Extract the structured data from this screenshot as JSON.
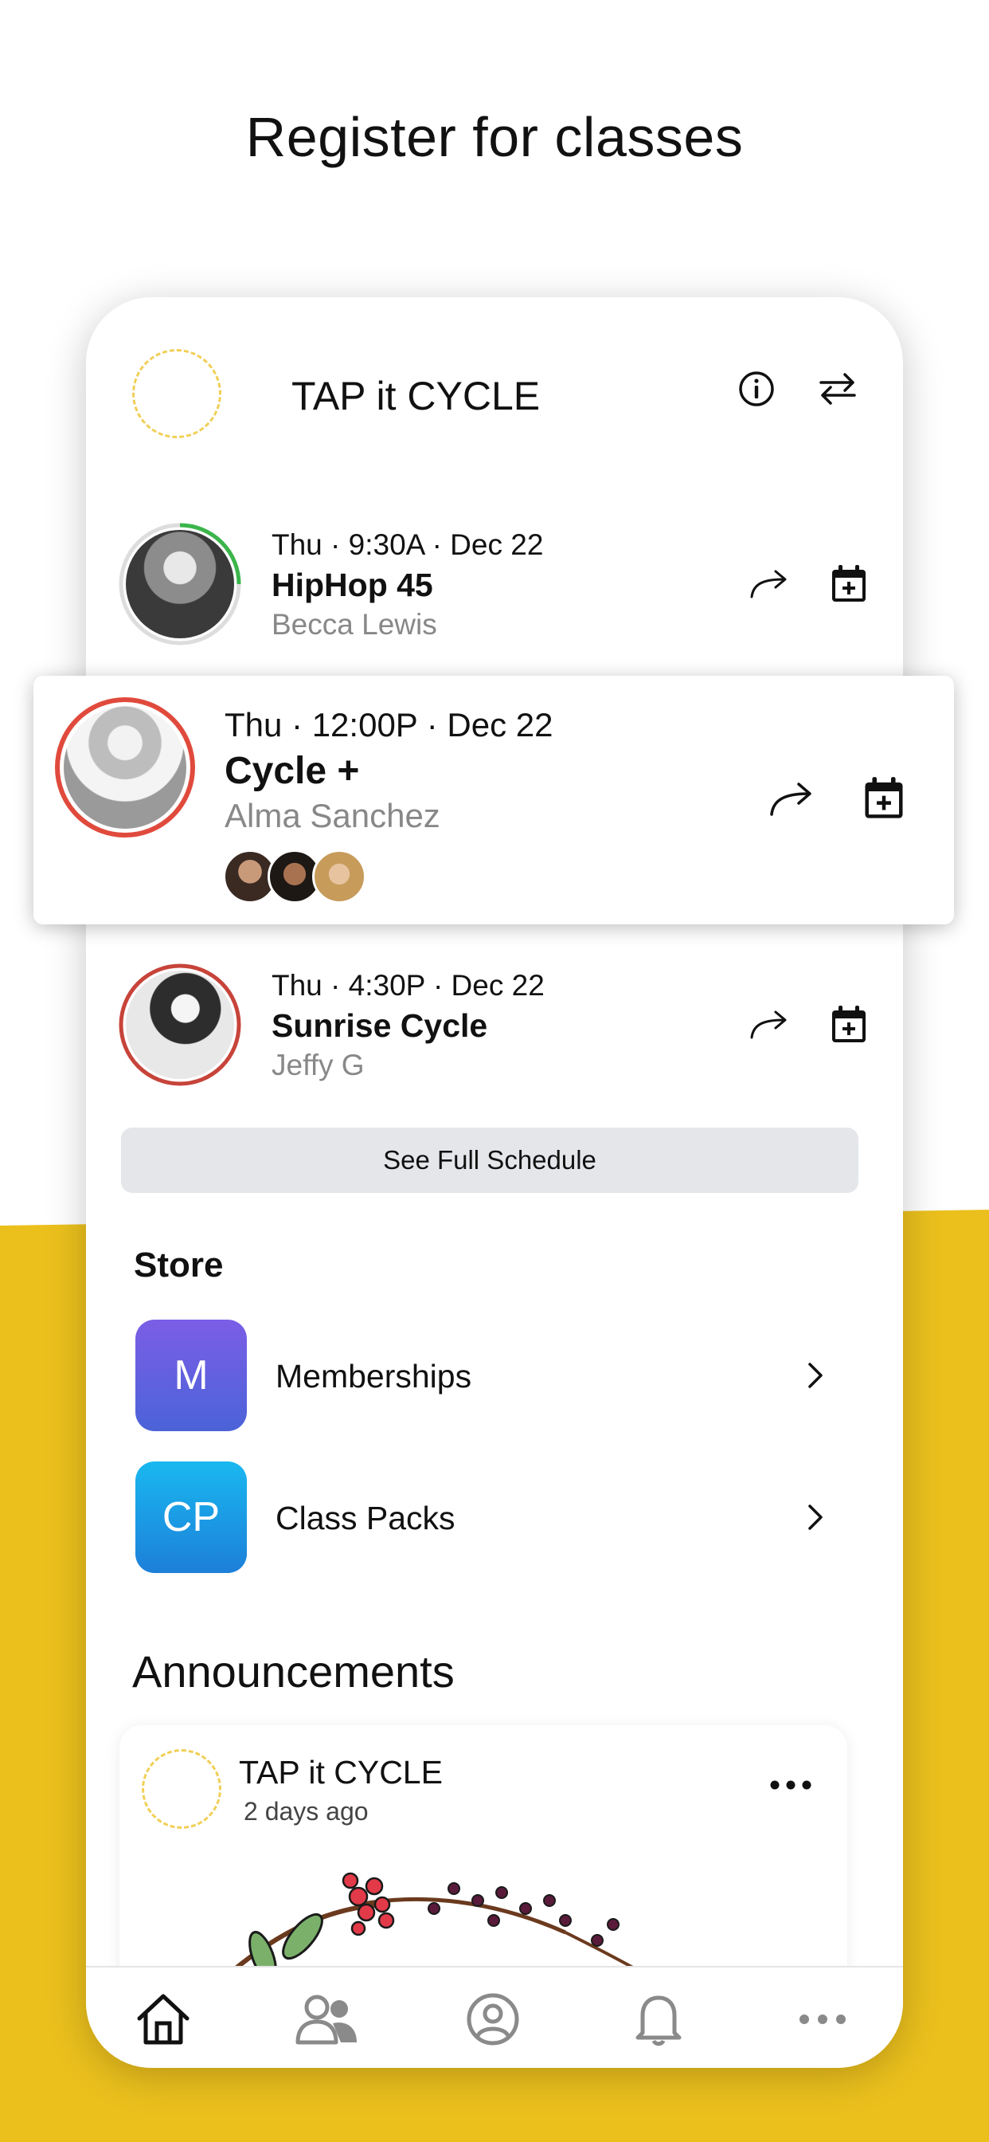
{
  "headline": "Register for classes",
  "header": {
    "studio_name": "TAP it CYCLE",
    "icons": [
      "info-icon",
      "swap-icon"
    ]
  },
  "classes": [
    {
      "time": "Thu · 9:30A · Dec 22",
      "title": "HipHop 45",
      "instructor": "Becca  Lewis",
      "ring_color": "#3bb54a",
      "ring_fill": 0.25
    },
    {
      "time": "Thu · 12:00P · Dec 22",
      "title": "Cycle +",
      "instructor": "Alma  Sanchez",
      "ring_color": "#e04a3c",
      "ring_fill": 1.0,
      "attendee_count": 3
    },
    {
      "time": "Thu · 4:30P · Dec 22",
      "title": "Sunrise Cycle",
      "instructor": "Jeffy G",
      "ring_color": "#c7443a",
      "ring_fill": 1.0
    }
  ],
  "schedule_button": "See Full Schedule",
  "store": {
    "title": "Store",
    "items": [
      {
        "badge": "M",
        "label": "Memberships",
        "colors": [
          "#7b5ee6",
          "#4b63d8"
        ]
      },
      {
        "badge": "CP",
        "label": "Class Packs",
        "colors": [
          "#19b8f0",
          "#1d7fd9"
        ]
      }
    ]
  },
  "announcements": {
    "title": "Announcements",
    "post": {
      "author": "TAP it CYCLE",
      "time": "2 days ago"
    }
  },
  "tabbar": {
    "tabs": [
      "home-icon",
      "people-icon",
      "profile-icon",
      "bell-icon",
      "more-icon"
    ],
    "active": "home-icon"
  },
  "colors": {
    "accent_yellow": "#ebc01d",
    "logo_dash": "#f1cf57"
  }
}
